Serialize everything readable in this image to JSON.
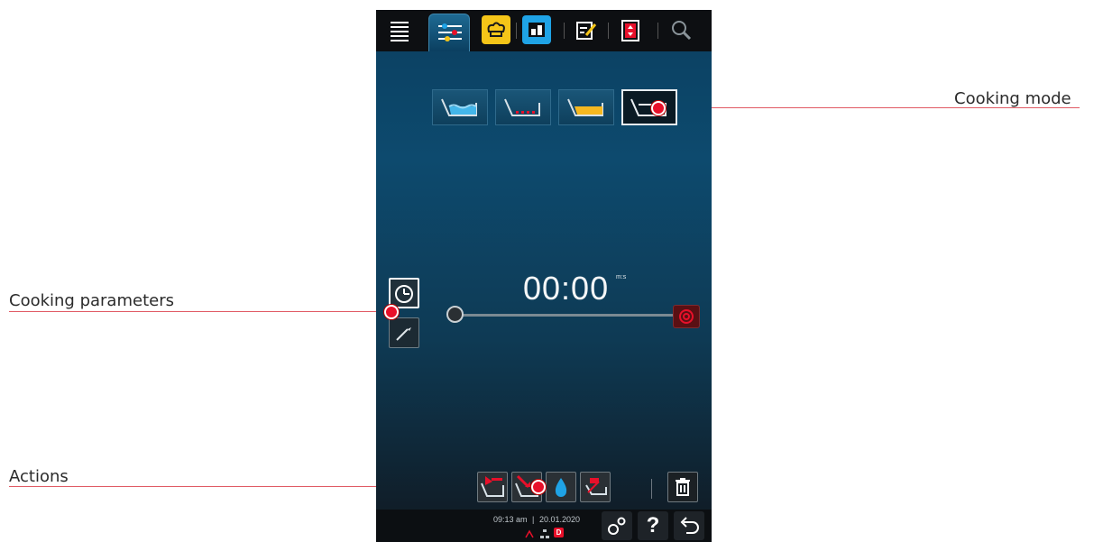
{
  "callouts": {
    "cooking_mode": "Cooking mode",
    "cooking_parameters": "Cooking parameters",
    "actions": "Actions"
  },
  "topbar": {
    "tabs": [
      {
        "icon": "menu-list-icon"
      },
      {
        "icon": "settings-sliders-icon",
        "active": true
      },
      {
        "icon": "chef-hat-icon"
      },
      {
        "icon": "program-cabinet-icon"
      },
      {
        "icon": "edit-note-icon"
      },
      {
        "icon": "vertical-expand-icon"
      },
      {
        "icon": "search-icon"
      }
    ]
  },
  "cooking_modes": [
    {
      "icon": "basin-water-icon"
    },
    {
      "icon": "basin-heating-icon"
    },
    {
      "icon": "basin-fry-icon"
    },
    {
      "icon": "basin-empty-icon",
      "selected": true
    }
  ],
  "timer": {
    "value": "00:00",
    "unit": "m:s"
  },
  "parameters": [
    {
      "icon": "clock-icon",
      "active": true
    },
    {
      "icon": "core-probe-icon"
    }
  ],
  "actions": [
    {
      "icon": "basin-fill-icon"
    },
    {
      "icon": "basin-drain-icon"
    },
    {
      "icon": "water-drop-icon"
    },
    {
      "icon": "lift-basket-icon"
    },
    {
      "icon": "trash-icon"
    }
  ],
  "status": {
    "time": "09:13 am",
    "date": "20.01.2020",
    "separator": "|",
    "badge": "D"
  },
  "bottom_buttons": [
    {
      "icon": "gears-icon"
    },
    {
      "icon": "help-icon",
      "label": "?"
    },
    {
      "icon": "back-arrow-icon"
    }
  ],
  "colors": {
    "callout_line": "#e05a64",
    "callout_dot": "#e8102a",
    "tab_yellow": "#f5c518",
    "tab_blue": "#1fa3e6"
  }
}
